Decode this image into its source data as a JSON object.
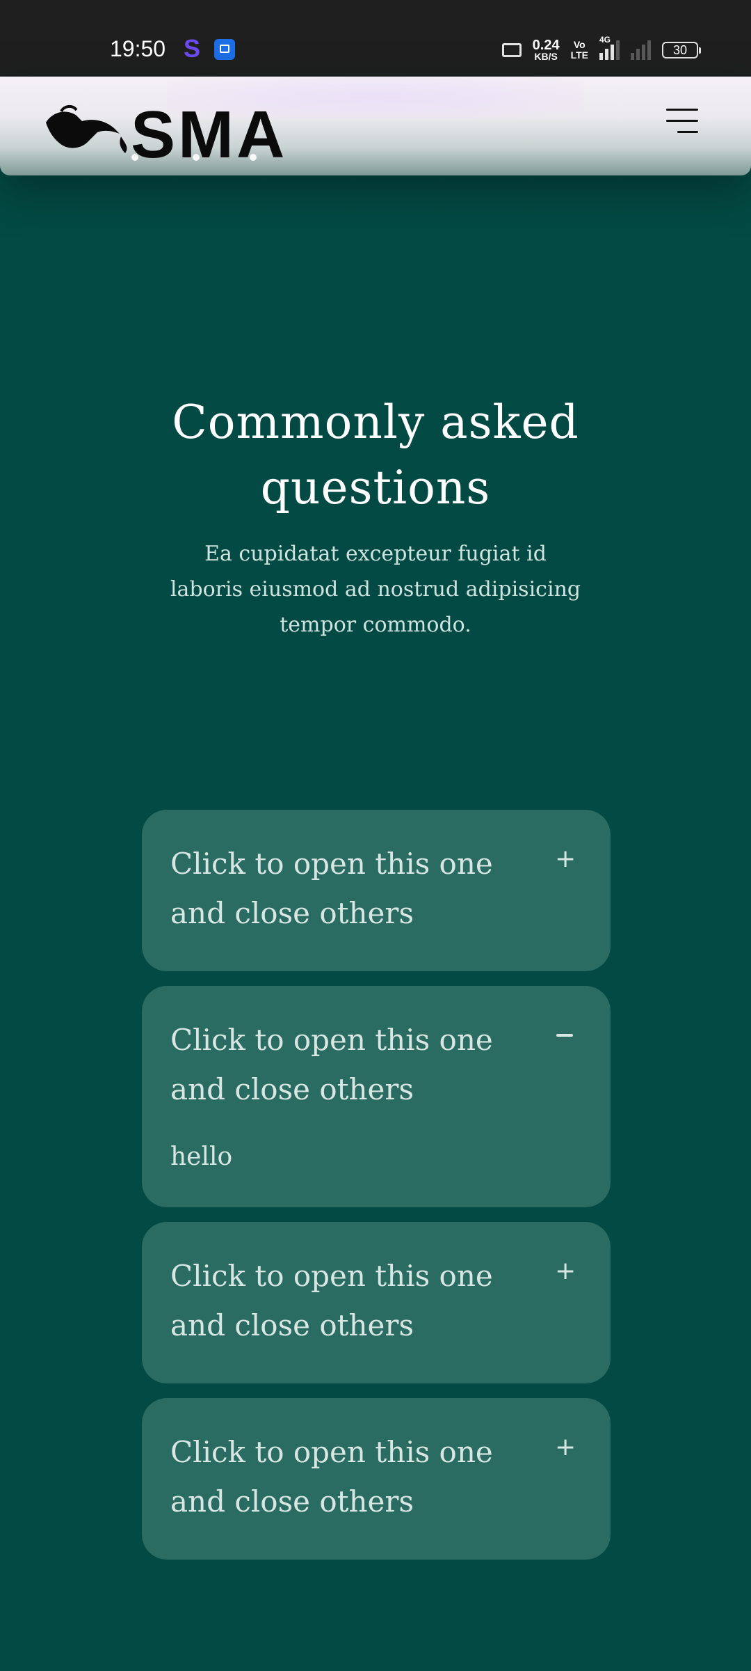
{
  "status_bar": {
    "time": "19:50",
    "speed_value": "0.24",
    "speed_unit": "KB/S",
    "volte_top": "Vo",
    "volte_bottom": "LTE",
    "network": "4G",
    "battery": "30",
    "app_icons": [
      "s-app-icon",
      "file-manager-icon"
    ]
  },
  "header": {
    "logo_text": "SMA",
    "logo_icon": "watering-can-icon",
    "menu_icon": "hamburger-menu-icon"
  },
  "faq": {
    "title": "Commonly asked questions",
    "subtitle": "Ea cupidatat excepteur fugiat id laboris eiusmod ad nostrud adipisicing tempor commodo.",
    "items": [
      {
        "question": "Click to open this one and close others",
        "toggle": "+",
        "open": false,
        "answer": ""
      },
      {
        "question": "Click to open this one and close others",
        "toggle": "−",
        "open": true,
        "answer": "hello"
      },
      {
        "question": "Click to open this one and close others",
        "toggle": "+",
        "open": false,
        "answer": ""
      },
      {
        "question": "Click to open this one and close others",
        "toggle": "+",
        "open": false,
        "answer": ""
      }
    ]
  },
  "colors": {
    "background": "#034a44",
    "card": "#2a6b62",
    "card_text": "#d8e7e3",
    "title_text": "#ffffff",
    "status_bar": "#1f1f1f"
  }
}
